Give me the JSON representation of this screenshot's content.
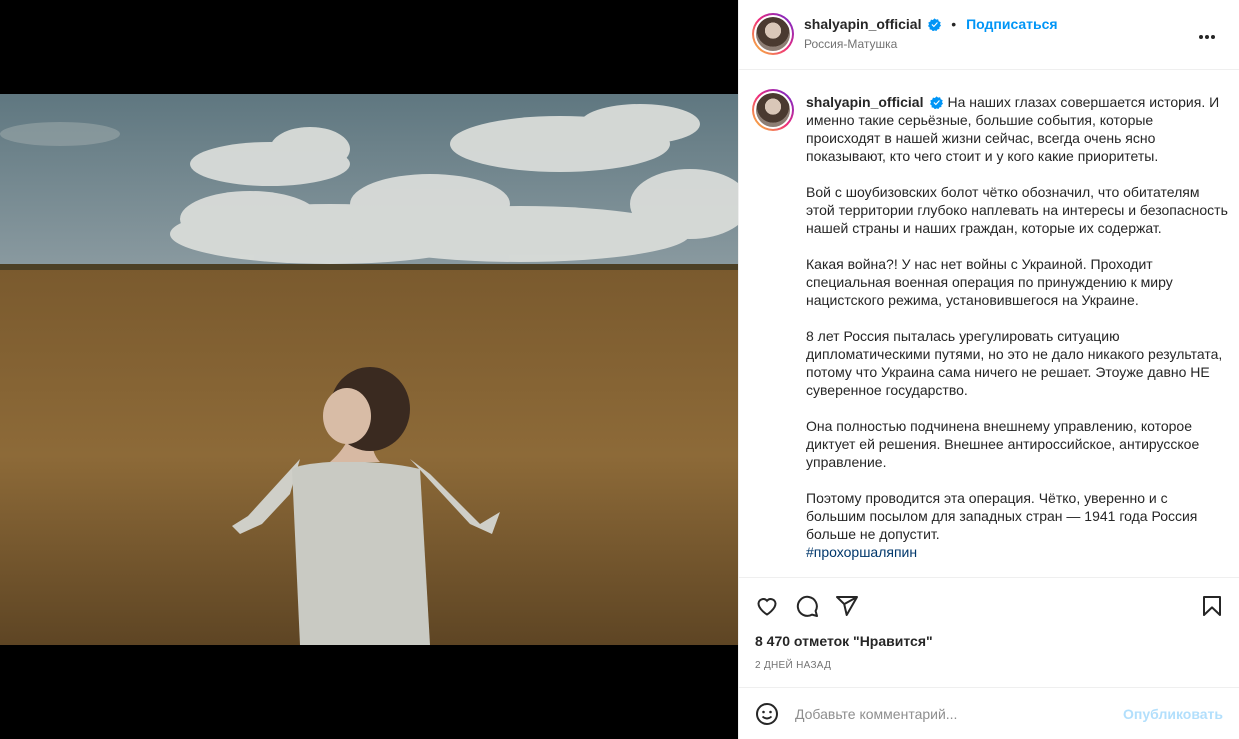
{
  "post": {
    "username": "shalyapin_official",
    "follow_label": "Подписаться",
    "location": "Россия-Матушка",
    "caption_paragraphs": [
      "На наших глазах совершается история. И именно такие серьёзные, большие события, которые происходят в нашей жизни сейчас, всегда очень ясно показывают, кто чего стоит и у кого какие приоритеты.",
      "Вой с шоубизовских болот чётко обозначил, что обитателям этой территории глубоко наплевать на интересы и безопасность нашей страны и наших граждан, которые их содержат.",
      "Какая война?! У нас нет войны с Украиной. Проходит специальная военная операция по принуждению к миру нацистского режима, установившегося на Украине.",
      "8 лет Россия пыталась урегулировать ситуацию дипломатическими путями, но это не дало никакого результата, потому что Украина сама ничего не решает. Этоуже давно НЕ суверенное государство.",
      "Она полностью подчинена внешнему управлению, которое диктует ей решения. Внешнее антироссийское, антирусское управление.",
      "Поэтому проводится эта операция. Чётко, уверенно и с большим посылом для западных стран — 1941 года Россия больше не допустит."
    ],
    "hashtag": "#прохоршаляпин",
    "likes": "8 470 отметок \"Нравится\"",
    "time": "2 ДНЕЙ НАЗАД"
  },
  "comment_box": {
    "placeholder": "Добавьте комментарий...",
    "publish_label": "Опубликовать"
  },
  "icons": {
    "like": "heart-icon",
    "comment": "comment-icon",
    "share": "paper-plane-icon",
    "save": "bookmark-icon",
    "more": "more-dots-icon",
    "emoji": "emoji-icon",
    "verified": "verified-badge-icon"
  },
  "colors": {
    "accent": "#0095f6",
    "publish_disabled": "#b2dffc",
    "hashtag": "#00376b",
    "muted": "#737373"
  }
}
